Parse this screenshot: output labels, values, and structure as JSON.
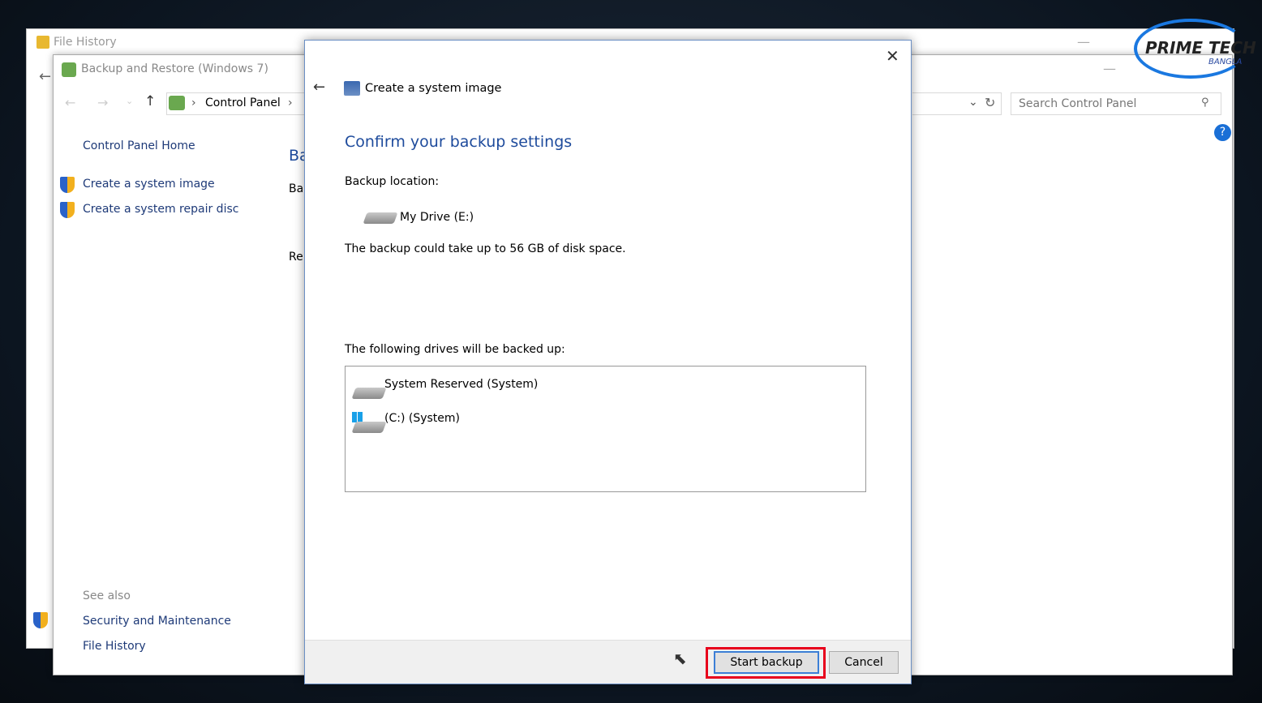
{
  "file_history": {
    "title": "File History"
  },
  "backup_restore": {
    "title": "Backup and Restore (Windows 7)",
    "breadcrumb": [
      "Control Panel"
    ],
    "search_placeholder": "Search Control Panel",
    "sidebar": {
      "home": "Control Panel Home",
      "items": [
        "Create a system image",
        "Create a system repair disc"
      ],
      "see_also": "See also",
      "see_also_items": [
        "Security and Maintenance",
        "File History"
      ]
    },
    "main_partial": [
      "Ba",
      "Ba",
      "Re"
    ]
  },
  "dialog": {
    "title": "Create a system image",
    "heading": "Confirm your backup settings",
    "location_label": "Backup location:",
    "location": "My Drive (E:)",
    "space_note": "The backup could take up to 56 GB of disk space.",
    "drives_label": "The following drives will be backed up:",
    "drives": [
      "System Reserved (System)",
      "(C:) (System)"
    ],
    "start_button": "Start backup",
    "cancel_button": "Cancel",
    "highlight_color": "#e8001c",
    "accent_color": "#1e4b9c"
  },
  "watermark": {
    "line1": "PRIME TECH",
    "line2": "BANGLA"
  }
}
